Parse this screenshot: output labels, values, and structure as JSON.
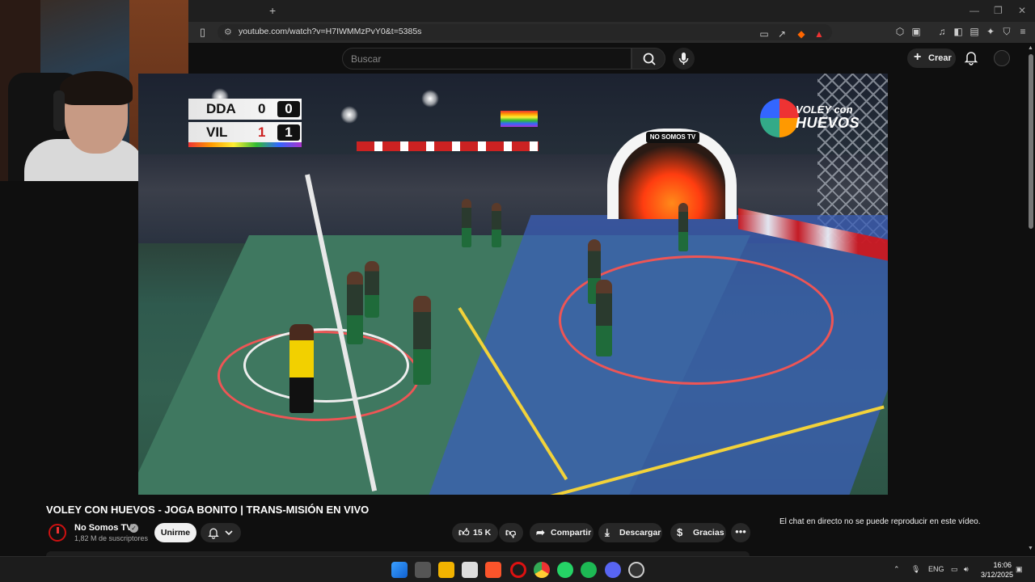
{
  "browser": {
    "url": "youtube.com/watch?v=H7IWMMzPvY0&t=5385s",
    "new_tab_symbol": "+"
  },
  "youtube": {
    "search_placeholder": "Buscar",
    "create_label": "Crear"
  },
  "video": {
    "scoreboard": {
      "team1": "DDA",
      "team1_sets": "0",
      "team1_points": "0",
      "team2": "VIL",
      "team2_sets": "1",
      "team2_points": "1"
    },
    "logo_line1": "VOLEY con",
    "logo_line2": "HUEVOS",
    "arch_label": "NO SOMOS TV"
  },
  "details": {
    "title": "VOLEY CON HUEVOS - JOGA BONITO | TRANS-MISIÓN EN VIVO",
    "channel_name": "No Somos TV",
    "subscribers": "1,82 M de suscriptores",
    "join_label": "Unirme",
    "likes": "15 K",
    "share_label": "Compartir",
    "download_label": "Descargar",
    "thanks_label": "Gracias",
    "chat_message": "El chat en directo no se puede reproducir en este vídeo."
  },
  "taskbar": {
    "lang": "ENG",
    "time": "16:06",
    "date": "3/12/2025"
  }
}
